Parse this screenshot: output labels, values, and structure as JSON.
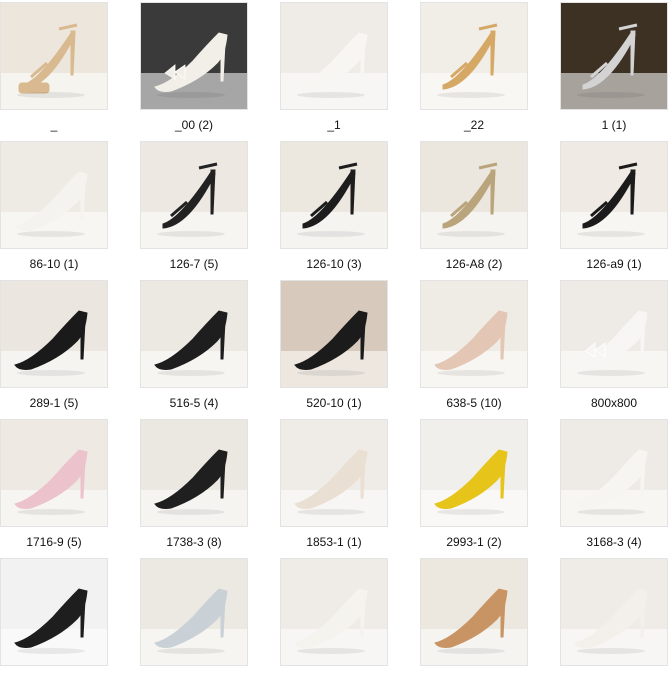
{
  "files": [
    {
      "name": "_",
      "icon": "beige-platform-sandal-icon",
      "bg": "#ece6dc",
      "shoe": "#d9b98f",
      "style": "sandal-platform"
    },
    {
      "name": "_00 (2)",
      "icon": "white-bow-heel-icon",
      "bg": "#3a3a3a",
      "shoe": "#f2eee8",
      "style": "bow"
    },
    {
      "name": "_1",
      "icon": "white-pump-icon",
      "bg": "#efece7",
      "shoe": "#f7f6f3",
      "style": "pump"
    },
    {
      "name": "_22",
      "icon": "gold-jeweled-sandal-icon",
      "bg": "#f1ede7",
      "shoe": "#d6a865",
      "style": "sandal"
    },
    {
      "name": "1 (1)",
      "icon": "silver-strappy-heel-icon",
      "bg": "#3d3124",
      "shoe": "#d3d3d3",
      "style": "strappy"
    },
    {
      "name": "86-10 (1)",
      "icon": "white-mule-icon",
      "bg": "#eeeae4",
      "shoe": "#f5f3ef",
      "style": "pump"
    },
    {
      "name": "126-7 (5)",
      "icon": "black-strappy-sandal-icon",
      "bg": "#ede8e2",
      "shoe": "#222222",
      "style": "sandal"
    },
    {
      "name": "126-10 (3)",
      "icon": "black-strappy-sandal-icon",
      "bg": "#ece7df",
      "shoe": "#1d1d1d",
      "style": "sandal"
    },
    {
      "name": "126-A8 (2)",
      "icon": "gold-strappy-sandal-icon",
      "bg": "#ebe6de",
      "shoe": "#b9a47b",
      "style": "sandal"
    },
    {
      "name": "126-a9 (1)",
      "icon": "black-ankle-strap-sandal-icon",
      "bg": "#efeae3",
      "shoe": "#1b1b1b",
      "style": "sandal"
    },
    {
      "name": "289-1 (5)",
      "icon": "black-platform-pump-icon",
      "bg": "#ebe6df",
      "shoe": "#1a1a1a",
      "style": "pump"
    },
    {
      "name": "516-5 (4)",
      "icon": "black-crystal-pump-icon",
      "bg": "#ece8e2",
      "shoe": "#1e1e1e",
      "style": "pump"
    },
    {
      "name": "520-10 (1)",
      "icon": "black-crystal-ankle-pump-icon",
      "bg": "#d7c9bb",
      "shoe": "#1b1b1b",
      "style": "pump"
    },
    {
      "name": "638-5 (10)",
      "icon": "nude-pump-icon",
      "bg": "#efebe5",
      "shoe": "#e3c6b4",
      "style": "pump"
    },
    {
      "name": "800x800",
      "icon": "white-bow-pump-icon",
      "bg": "#eeeae5",
      "shoe": "#f7f6f4",
      "style": "bow"
    },
    {
      "name": "1716-9 (5)",
      "icon": "pink-gradient-pump-icon",
      "bg": "#eee9e3",
      "shoe": "#ecc3cc",
      "style": "pump"
    },
    {
      "name": "1738-3 (8)",
      "icon": "black-suede-crystal-pump-icon",
      "bg": "#ebe7e1",
      "shoe": "#1f1f1f",
      "style": "pump"
    },
    {
      "name": "1853-1 (1)",
      "icon": "lace-pump-icon",
      "bg": "#efece7",
      "shoe": "#eadfd3",
      "style": "pump"
    },
    {
      "name": "2993-1 (2)",
      "icon": "yellow-satin-pump-icon",
      "bg": "#f1efec",
      "shoe": "#e6c419",
      "style": "pump"
    },
    {
      "name": "3168-3 (4)",
      "icon": "white-pointed-pump-icon",
      "bg": "#eeeae5",
      "shoe": "#f6f5f2",
      "style": "pump"
    },
    {
      "name": "",
      "icon": "black-suede-pump-icon",
      "bg": "#f2f2f2",
      "shoe": "#1e1e1e",
      "style": "pump"
    },
    {
      "name": "",
      "icon": "glitter-pump-icon",
      "bg": "#ece8e2",
      "shoe": "#c9d1d6",
      "style": "pump"
    },
    {
      "name": "",
      "icon": "white-satin-pump-icon",
      "bg": "#efece7",
      "shoe": "#f5f3ee",
      "style": "pump"
    },
    {
      "name": "",
      "icon": "gold-metallic-pump-icon",
      "bg": "#ece7df",
      "shoe": "#c89464",
      "style": "pump"
    },
    {
      "name": "",
      "icon": "white-pump-icon",
      "bg": "#efebe6",
      "shoe": "#f3f0ec",
      "style": "pump"
    }
  ]
}
